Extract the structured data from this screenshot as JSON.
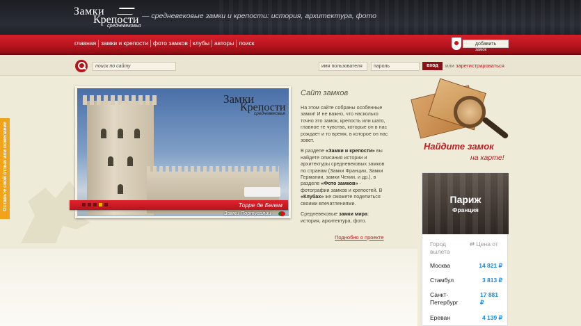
{
  "site": {
    "logo_line1": "Замки",
    "logo_line2": "Крепости",
    "logo_line3": "средневековья",
    "tagline": "— средневековые замки и крепости: история, архитектура, фото"
  },
  "nav": {
    "items": [
      "главная",
      "замки и крепости",
      "фото замков",
      "клубы",
      "авторы",
      "поиск"
    ]
  },
  "add_castle": {
    "button": "добавить",
    "sub": "замок"
  },
  "search": {
    "placeholder": "поиск по сайту",
    "username_placeholder": "имя пользователя",
    "password_placeholder": "пароль",
    "login_button": "вход",
    "or_text": "или",
    "register_link": "зарегистрироваться"
  },
  "side_feedback": "Оставьте свой отзыв или пожелание",
  "slideshow": {
    "caption": "Торре де Белем",
    "subcaption": "Замки Португалии",
    "dots": [
      false,
      false,
      false,
      true,
      false
    ],
    "watermark1": "Замки",
    "watermark2": "Крепости",
    "watermark3": "средневековья"
  },
  "about": {
    "title": "Сайт замков",
    "p1": "На этом сайте собраны особенные замки! И не важно, что насколько точно это замок, крепость или шато, главное те чувства, которые он в нас рождает и то время, в которое он нас зовет.",
    "p2_pre": "В разделе ",
    "p2_bold1": "«Замки и крепости»",
    "p2_mid": " вы найдете описания истории и архитектуры средневековых замков по странам (Замки Франции, Замки Германии, замки Чехии,  и др.), в разделе ",
    "p2_bold2": "«Фото замков»",
    "p2_mid2": " - фотографии замков и крепостей.  В ",
    "p2_bold3": "«Клубах»",
    "p2_end": " же сможете поделиться своими впечатлениями.",
    "p3_pre": "Средневековые ",
    "p3_bold": "замки мира",
    "p3_end": ": история, архитектура, фото.",
    "more_link": "Поднобно о проекте"
  },
  "map_promo": {
    "title": "Найдите замок",
    "subtitle": "на карте!"
  },
  "flight_card": {
    "city": "Париж",
    "country": "Франция",
    "col_city": "Город вылета",
    "col_price": "Цена от",
    "rows": [
      {
        "city": "Москва",
        "price": "14 821 ₽"
      },
      {
        "city": "Стамбул",
        "price": "3 813 ₽"
      },
      {
        "city": "Санкт-Петербург",
        "price": "17 881 ₽"
      },
      {
        "city": "Ереван",
        "price": "4 139 ₽"
      }
    ]
  },
  "colors": {
    "brand_red": "#c01a20",
    "accent_orange": "#f2a31a",
    "price_blue": "#1a8ae6"
  }
}
